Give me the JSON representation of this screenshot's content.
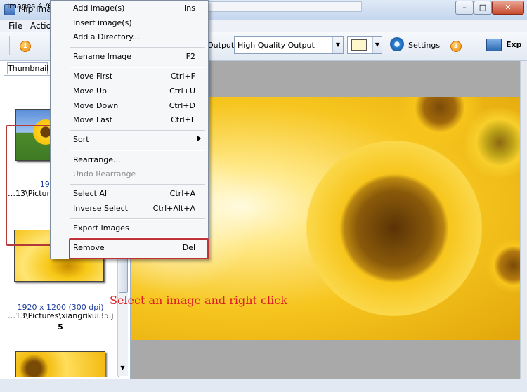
{
  "window": {
    "title": "Flip Image",
    "controls": {
      "minimize": "–",
      "maximize": "□",
      "close": "✕"
    }
  },
  "menu_bar": [
    "File",
    "Action"
  ],
  "toolbar": {
    "step1": "1",
    "step3": "3",
    "output_label": "Output:",
    "output_value": "High Quality Output",
    "color_swatch": "#fff7cc",
    "settings_label": "Settings",
    "export_label": "Exp"
  },
  "left_panel": {
    "tab": "Thumbnail",
    "thumbnails": [
      {
        "info": "1920 x 1",
        "path": "…13\\Pictures"
      },
      {
        "info": "1920 x 1200 (300 dpi)",
        "path": "…13\\Pictures\\xiangrikui35.jpg",
        "number": "5"
      }
    ]
  },
  "context_menu": {
    "items": [
      {
        "label": "Add image(s)",
        "shortcut": "Ins"
      },
      {
        "label": "Insert image(s)",
        "shortcut": ""
      },
      {
        "label": "Add a Directory...",
        "shortcut": ""
      },
      {
        "label": "Rename Image",
        "shortcut": "F2"
      },
      {
        "label": "Move First",
        "shortcut": "Ctrl+F"
      },
      {
        "label": "Move Up",
        "shortcut": "Ctrl+U"
      },
      {
        "label": "Move Down",
        "shortcut": "Ctrl+D"
      },
      {
        "label": "Move Last",
        "shortcut": "Ctrl+L"
      },
      {
        "label": "Sort",
        "shortcut": ""
      },
      {
        "label": "Rearrange...",
        "shortcut": ""
      },
      {
        "label": "Undo Rearrange",
        "shortcut": ""
      },
      {
        "label": "Select All",
        "shortcut": "Ctrl+A"
      },
      {
        "label": "Inverse Select",
        "shortcut": "Ctrl+Alt+A"
      },
      {
        "label": "Export Images",
        "shortcut": ""
      },
      {
        "label": "Remove",
        "shortcut": "Del"
      }
    ]
  },
  "annotation": "Select an image and right click",
  "status_bar": {
    "text": "Images 4 /6"
  },
  "colors": {
    "annotation": "#e01b24",
    "highlight_box": "#c0323a"
  }
}
